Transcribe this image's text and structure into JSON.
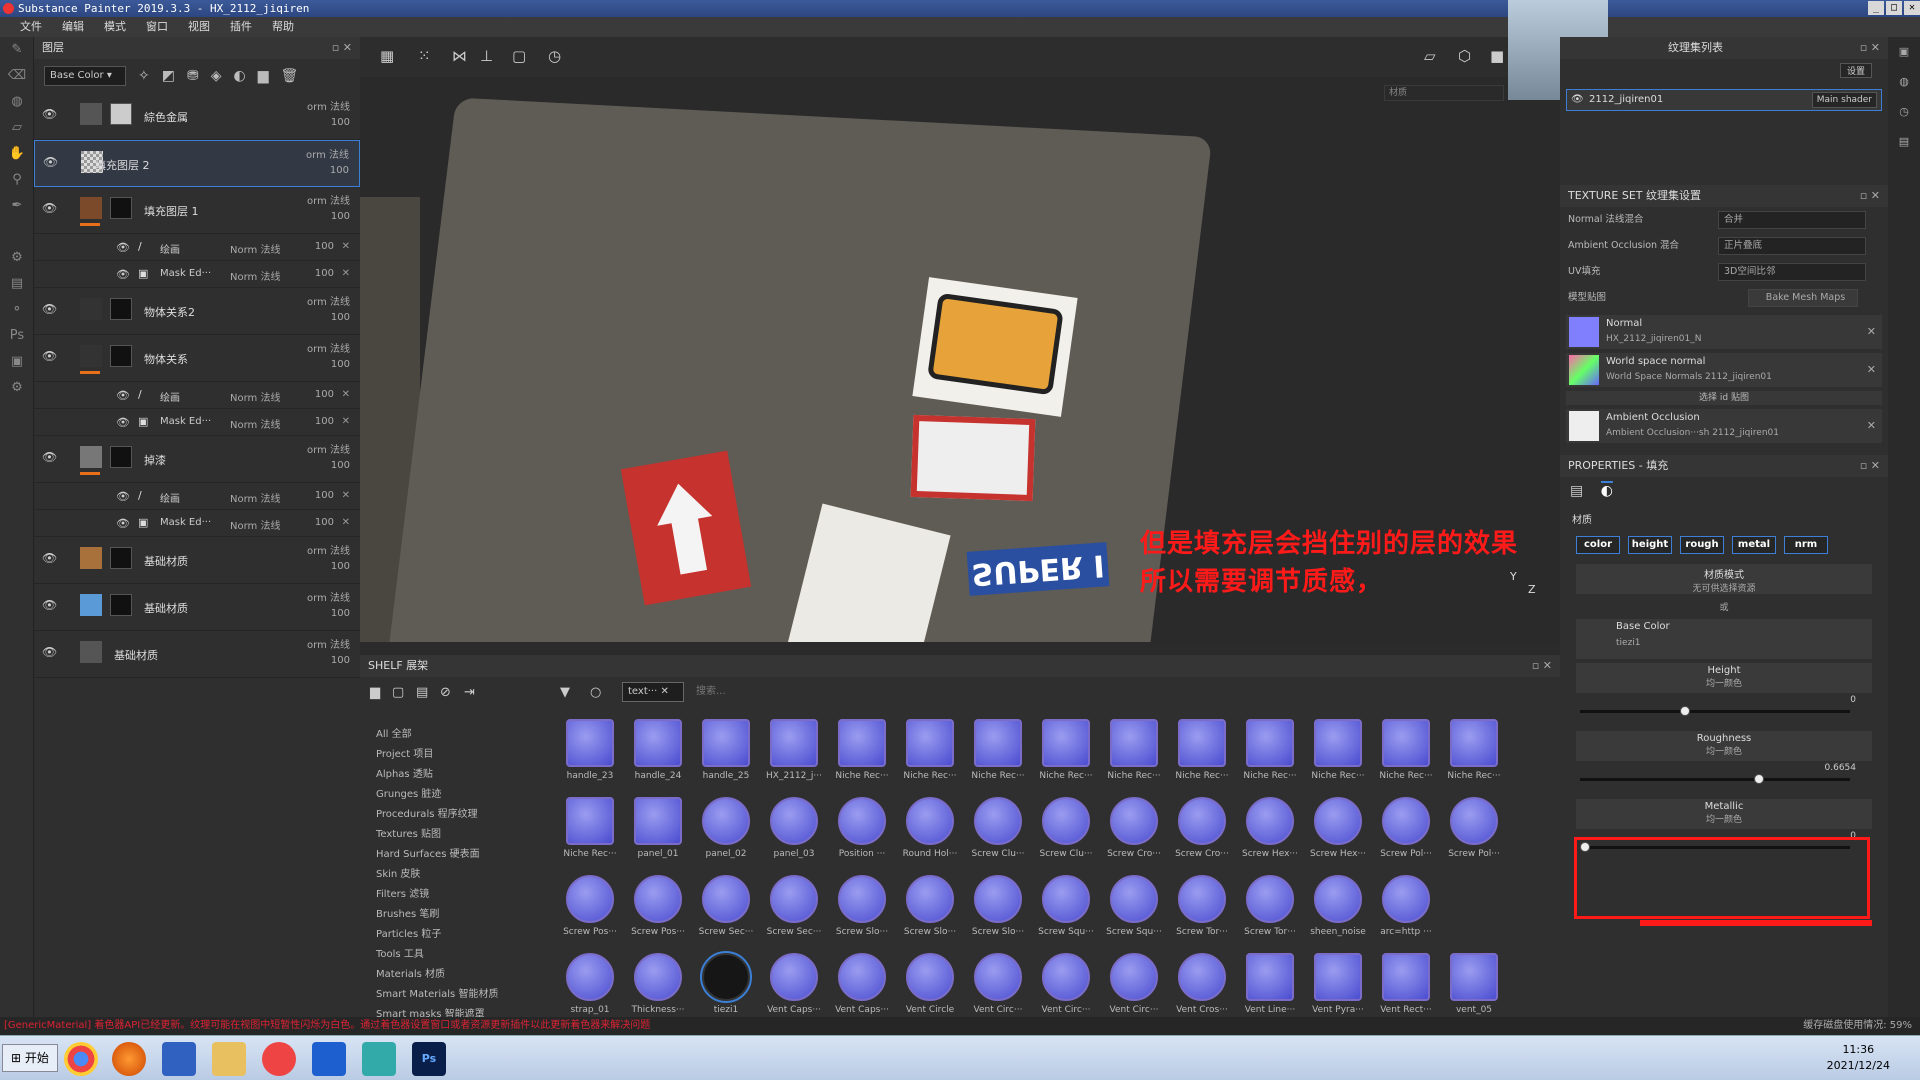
{
  "window": {
    "title": "Substance Painter 2019.3.3 - HX_2112_jiqiren"
  },
  "menu": [
    "文件",
    "编辑",
    "模式",
    "窗口",
    "视图",
    "插件",
    "帮助"
  ],
  "layers_panel": {
    "title": "图层",
    "channel": "Base Color",
    "layers": [
      {
        "name": "綜色金属",
        "blend": "orm 法线",
        "opacity": "100"
      },
      {
        "name": "填充图层 2",
        "blend": "orm 法线",
        "opacity": "100"
      },
      {
        "name": "填充图层 1",
        "blend": "orm 法线",
        "opacity": "100"
      },
      {
        "name": "物体关系2",
        "blend": "orm 法线",
        "opacity": "100"
      },
      {
        "name": "物体关系",
        "blend": "orm 法线",
        "opacity": "100"
      },
      {
        "name": "掉漆",
        "blend": "orm 法线",
        "opacity": "100"
      },
      {
        "name": "基础材质",
        "blend": "orm 法线",
        "opacity": "100"
      },
      {
        "name": "基础材质",
        "blend": "orm 法线",
        "opacity": "100"
      },
      {
        "name": "基础材质",
        "blend": "orm 法线",
        "opacity": "100"
      }
    ],
    "sub_paint": "绘画",
    "sub_mask": "Mask Ed···",
    "sub_blend": "Norm 法线",
    "sub_opacity": "100"
  },
  "viewport": {
    "material_field": "材质",
    "sticker_text": "SUPER I",
    "axis_y": "Y",
    "axis_z": "Z",
    "annotation_line1": "但是填充层会挡住别的层的效果",
    "annotation_line2": "所以需要调节质感，"
  },
  "shelf": {
    "title": "SHELF 展架",
    "filter_tag": "text···",
    "search_placeholder": "搜索...",
    "categories": [
      "All 全部",
      "Project 项目",
      "Alphas 透贴",
      "Grunges 脏迹",
      "Procedurals 程序纹理",
      "Textures 贴图",
      "Hard Surfaces 硬表面",
      "Skin 皮肤",
      "Filters 滤镜",
      "Brushes 笔刷",
      "Particles 粒子",
      "Tools 工具",
      "Materials 材质",
      "Smart Materials 智能材质",
      "Smart masks 智能遮罩"
    ],
    "items": [
      "handle_23",
      "handle_24",
      "handle_25",
      "HX_2112_j···",
      "Niche Rec···",
      "Niche Rec···",
      "Niche Rec···",
      "Niche Rec···",
      "Niche Rec···",
      "Niche Rec···",
      "Niche Rec···",
      "Niche Rec···",
      "Niche Rec···",
      "Niche Rec···",
      "Niche Rec···",
      "panel_01",
      "panel_02",
      "panel_03",
      "Position ···",
      "Round Hol···",
      "Screw Clu···",
      "Screw Clu···",
      "Screw Cro···",
      "Screw Cro···",
      "Screw Hex···",
      "Screw Hex···",
      "Screw Pol···",
      "Screw Pol···",
      "Screw Pos···",
      "Screw Pos···",
      "Screw Sec···",
      "Screw Sec···",
      "Screw Slo···",
      "Screw Slo···",
      "Screw Slo···",
      "Screw Squ···",
      "Screw Squ···",
      "Screw Tor···",
      "Screw Tor···",
      "sheen_noise",
      "arc=http ···",
      "",
      "strap_01",
      "Thickness···",
      "tiezi1",
      "Vent Caps···",
      "Vent Caps···",
      "Vent Circle",
      "Vent Circ···",
      "Vent Circ···",
      "Vent Circ···",
      "Vent Cros···",
      "Vent Line···",
      "Vent Pyra···",
      "Vent Rect···",
      "vent_05"
    ]
  },
  "texture_set_list": {
    "title": "纹理集列表",
    "settings": "设置",
    "set_name": "2112_jiqiren01",
    "shader": "Main shader"
  },
  "texture_set_settings": {
    "title": "TEXTURE SET 纹理集设置",
    "normal_label": "Normal 法线混合",
    "normal_value": "合并",
    "ao_label": "Ambient Occlusion 混合",
    "ao_value": "正片叠底",
    "uv_label": "UV填充",
    "uv_value": "3D空间比邻",
    "maps_label": "模型贴图",
    "bake_button": "Bake Mesh Maps",
    "maps": [
      {
        "title": "Normal",
        "sub": "HX_2112_jiqiren01_N"
      },
      {
        "title": "World space normal",
        "sub": "World Space Normals 2112_jiqiren01"
      },
      {
        "title": "Ambient Occlusion",
        "sub": "Ambient Occlusion···sh 2112_jiqiren01"
      }
    ],
    "id_map": "选择 id 贴图"
  },
  "properties": {
    "title": "PROPERTIES - 填充",
    "material_label": "材质",
    "channels": [
      "color",
      "height",
      "rough",
      "metal",
      "nrm"
    ],
    "mode_title": "材质模式",
    "mode_sub": "无可供选择资源",
    "or_label": "或",
    "base_color_title": "Base Color",
    "base_color_value": "tiezi1",
    "height_title": "Height",
    "height_sub": "均一颜色",
    "height_value": "0",
    "roughness_title": "Roughness",
    "roughness_sub": "均一颜色",
    "roughness_value": "0.6654",
    "metallic_title": "Metallic",
    "metallic_sub": "均一颜色",
    "metallic_value": "0"
  },
  "status": {
    "message": "[GenericMaterial] 着色器API已经更新。纹理可能在视图中短暂性闪烁为白色。通过着色器设置窗口或者资源更新插件以此更新着色器来解决问题",
    "cache": "缓存磁盘使用情况:  59%"
  },
  "taskbar": {
    "start": "开始",
    "time": "11:36",
    "date": "2021/12/24"
  }
}
